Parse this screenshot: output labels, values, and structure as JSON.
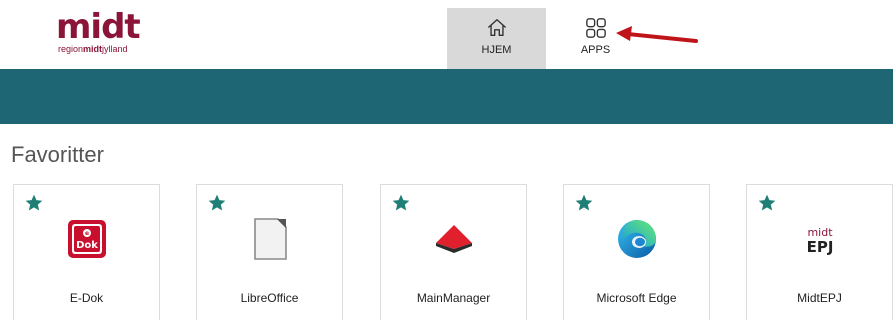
{
  "header": {
    "logo_main": "midt",
    "logo_sub_prefix": "region",
    "logo_sub_bold": "midt",
    "logo_sub_suffix": "jylland",
    "nav": [
      {
        "label": "HJEM",
        "icon": "home-icon",
        "active": true
      },
      {
        "label": "APPS",
        "icon": "apps-grid-icon",
        "active": false
      }
    ]
  },
  "colors": {
    "brand": "#8a1538",
    "teal": "#1f6674",
    "star": "#1f7f76",
    "arrow": "#c0141b"
  },
  "favorites": {
    "title": "Favoritter",
    "tiles": [
      {
        "label": "E-Dok",
        "icon": "e-dok-icon",
        "icon_text": "Dok",
        "favorite": true
      },
      {
        "label": "LibreOffice",
        "icon": "libreoffice-icon",
        "favorite": true
      },
      {
        "label": "MainManager",
        "icon": "mainmanager-icon",
        "favorite": true
      },
      {
        "label": "Microsoft Edge",
        "icon": "microsoft-edge-icon",
        "favorite": true
      },
      {
        "label": "MidtEPJ",
        "icon": "midtepj-icon",
        "icon_text_top": "midt",
        "icon_text_bottom": "EPJ",
        "favorite": true
      }
    ]
  }
}
